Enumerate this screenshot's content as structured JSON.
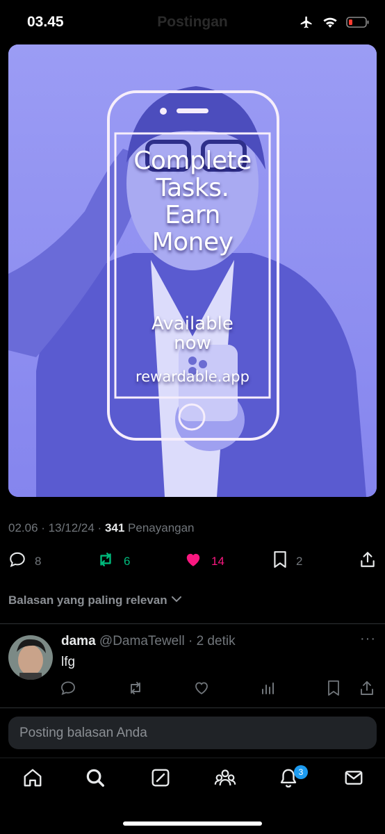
{
  "status_bar": {
    "time": "03.45",
    "header_title": "Postingan"
  },
  "post": {
    "image": {
      "headline": "Complete\nTasks.\nEarn\nMoney",
      "subline": "Available\nnow",
      "site": "rewardable.app"
    },
    "timestamp": "02.06 · 13/12/24 · ",
    "views_count": "341",
    "views_label": " Penayangan",
    "actions": {
      "replies": "8",
      "reposts": "6",
      "likes": "14",
      "bookmarks": "2"
    },
    "colors": {
      "repost": "#00ba7c",
      "like": "#f91880",
      "muted": "#71767b"
    }
  },
  "sort": {
    "label": "Balasan yang paling relevan"
  },
  "reply": {
    "name": "dama",
    "handle": "@DamaTewell",
    "time": " · 2 detik",
    "text": "lfg",
    "more": "···"
  },
  "compose": {
    "placeholder": "Posting balasan Anda"
  },
  "nav": {
    "notifications_badge": "3",
    "icons": [
      "home-icon",
      "search-icon",
      "grok-icon",
      "communities-icon",
      "bell-icon",
      "mail-icon"
    ]
  }
}
